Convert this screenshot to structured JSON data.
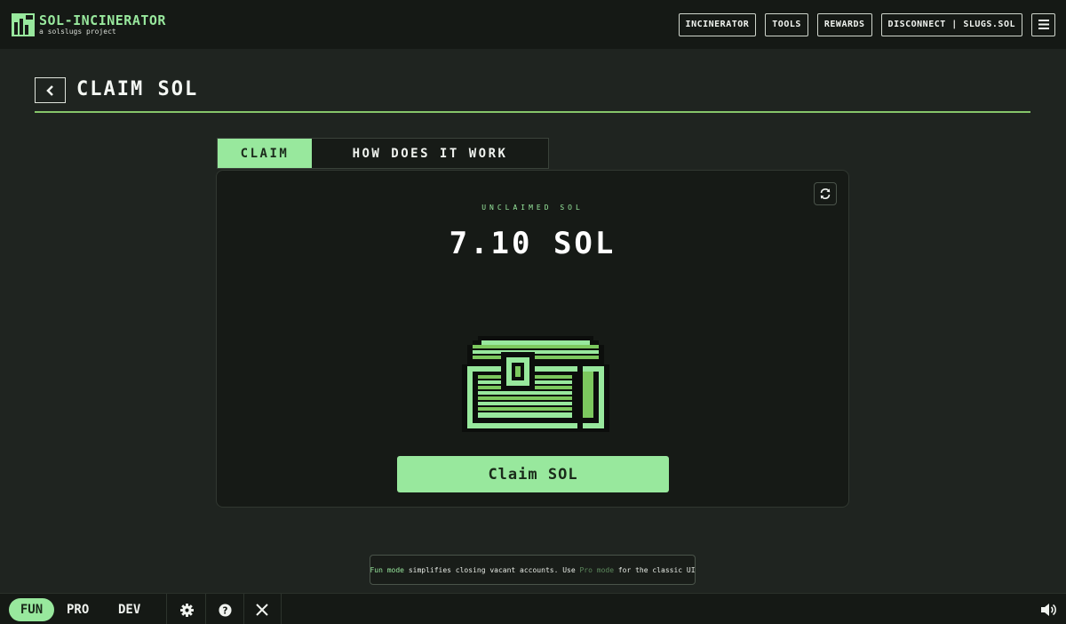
{
  "header": {
    "brand_title": "SOL-INCINERATOR",
    "brand_subtitle": "a solslugs project",
    "nav": [
      {
        "label": "INCINERATOR"
      },
      {
        "label": "TOOLS"
      },
      {
        "label": "REWARDS"
      },
      {
        "label": "DISCONNECT | SLUGS.SOL"
      }
    ],
    "menu_icon": "hamburger-icon"
  },
  "page": {
    "title": "CLAIM SOL",
    "back_icon": "chevron-left-icon"
  },
  "tabs": [
    {
      "label": "CLAIM",
      "active": true
    },
    {
      "label": "HOW DOES IT WORK",
      "active": false
    }
  ],
  "card": {
    "label": "UNCLAIMED SOL",
    "amount": "7.10 SOL",
    "refresh_icon": "refresh-icon",
    "illustration": "treasure-chest",
    "button_label": "Claim SOL"
  },
  "notice": {
    "fun": "Fun mode",
    "text1": " simplifies closing vacant accounts. Use ",
    "pro": "Pro mode",
    "text2": " for the classic UI"
  },
  "footer": {
    "modes": [
      {
        "label": "FUN",
        "active": true
      },
      {
        "label": "PRO",
        "active": false
      },
      {
        "label": "DEV",
        "active": false
      }
    ],
    "icons": [
      "gear-icon",
      "help-icon",
      "x-logo-icon",
      "speaker-icon"
    ]
  },
  "colors": {
    "accent": "#98e89d",
    "background": "#1f2420",
    "panel": "#161a16",
    "rule": "#86c56a"
  }
}
